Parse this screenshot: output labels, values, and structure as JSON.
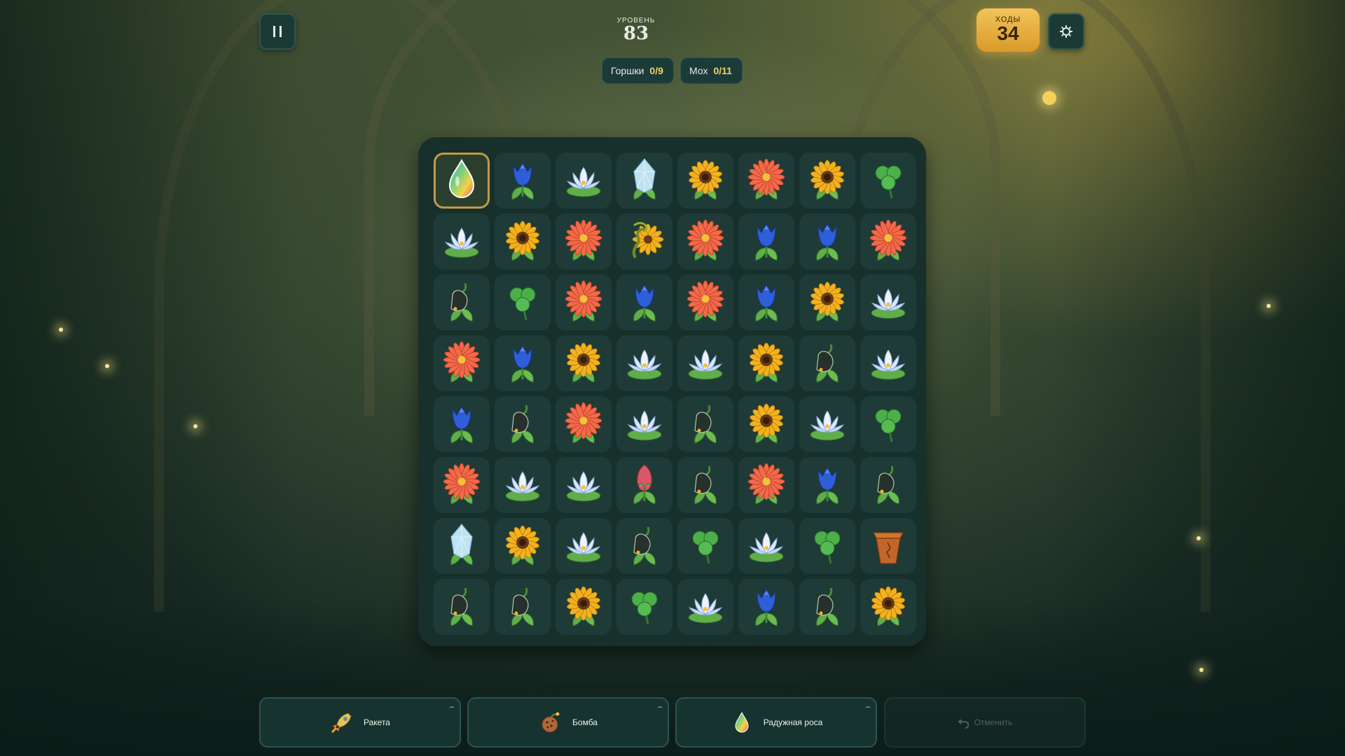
{
  "hud": {
    "pause_icon": "pause-icon",
    "level_label": "УРОВЕНЬ",
    "level_number": "83",
    "moves_label": "ХОДЫ",
    "moves_count": "34",
    "settings_icon": "gear-icon",
    "goals": [
      {
        "label": "Горшки",
        "progress": "0/9"
      },
      {
        "label": "Мох",
        "progress": "0/11"
      }
    ]
  },
  "board": {
    "rows": 8,
    "cols": 8,
    "selected": [
      0,
      0
    ],
    "grid": [
      [
        "rainbow-drop",
        "tulip",
        "lotus",
        "crystal",
        "sunflower",
        "daisy",
        "sunflower",
        "clover"
      ],
      [
        "lotus",
        "sunflower",
        "daisy",
        "vine",
        "daisy",
        "tulip",
        "tulip",
        "daisy"
      ],
      [
        "bellflower",
        "clover",
        "daisy",
        "tulip",
        "daisy",
        "tulip",
        "sunflower",
        "lotus"
      ],
      [
        "daisy",
        "tulip",
        "sunflower",
        "lotus",
        "lotus",
        "sunflower",
        "bellflower",
        "lotus"
      ],
      [
        "tulip",
        "bellflower",
        "daisy",
        "lotus",
        "bellflower",
        "sunflower",
        "lotus",
        "clover"
      ],
      [
        "daisy",
        "lotus",
        "lotus",
        "bud",
        "bellflower",
        "daisy",
        "tulip",
        "bellflower"
      ],
      [
        "crystal",
        "sunflower",
        "lotus",
        "bellflower",
        "clover",
        "lotus",
        "clover",
        "pot"
      ],
      [
        "bellflower",
        "bellflower",
        "sunflower",
        "clover",
        "lotus",
        "tulip",
        "bellflower",
        "sunflower"
      ]
    ]
  },
  "boosters": [
    {
      "label": "Ракета",
      "icon": "rocket-icon",
      "count": "–",
      "enabled": true
    },
    {
      "label": "Бомба",
      "icon": "bomb-icon",
      "count": "–",
      "enabled": true
    },
    {
      "label": "Радужная роса",
      "icon": "rainbow-drop-icon",
      "count": "–",
      "enabled": true
    },
    {
      "label": "Отменить",
      "icon": "undo-icon",
      "enabled": false
    }
  ],
  "colors": {
    "accent_gold": "#f1c45a",
    "panel": "#1b3b38",
    "board_bg": "#18302c",
    "cell_bg": "#1f3b37"
  }
}
